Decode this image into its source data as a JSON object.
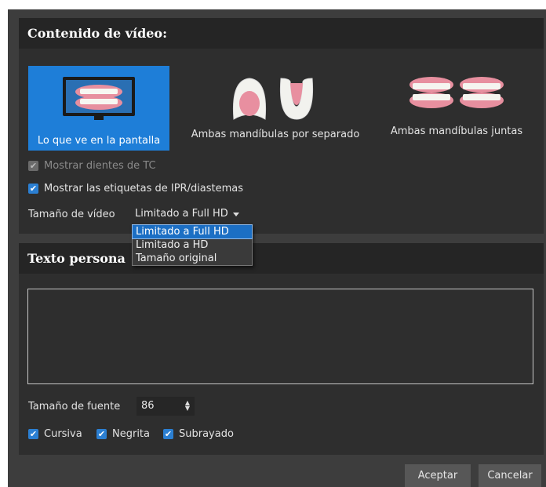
{
  "video_panel": {
    "title": "Contenido de vídeo:",
    "options": [
      {
        "label": "Lo que ve en la pantalla",
        "icon": "monitor-teeth-icon",
        "selected": true
      },
      {
        "label": "Ambas mandíbulas por separado",
        "icon": "separate-jaws-icon",
        "selected": false
      },
      {
        "label": "Ambas mandíbulas juntas",
        "icon": "joined-jaws-icon",
        "selected": false
      }
    ],
    "show_ct_teeth": {
      "label": "Mostrar dientes de TC",
      "checked": true,
      "disabled": true
    },
    "show_ipr_labels": {
      "label": "Mostrar las etiquetas de IPR/diastemas",
      "checked": true
    },
    "video_size_label": "Tamaño de vídeo",
    "video_size_value": "Limitado a Full HD",
    "video_size_options": [
      "Limitado a Full HD",
      "Limitado a HD",
      "Tamaño original"
    ]
  },
  "text_panel": {
    "title_visible": "Texto persona",
    "text_value": "",
    "font_size_label": "Tamaño de fuente",
    "font_size_value": "86",
    "italic": {
      "label": "Cursiva",
      "checked": true
    },
    "bold": {
      "label": "Negrita",
      "checked": true
    },
    "underline": {
      "label": "Subrayado",
      "checked": true
    }
  },
  "buttons": {
    "accept": "Aceptar",
    "cancel": "Cancelar"
  },
  "colors": {
    "accent": "#1e7ed8",
    "panel": "#2e2e2e",
    "header": "#252525",
    "background": "#3d3d3d"
  }
}
